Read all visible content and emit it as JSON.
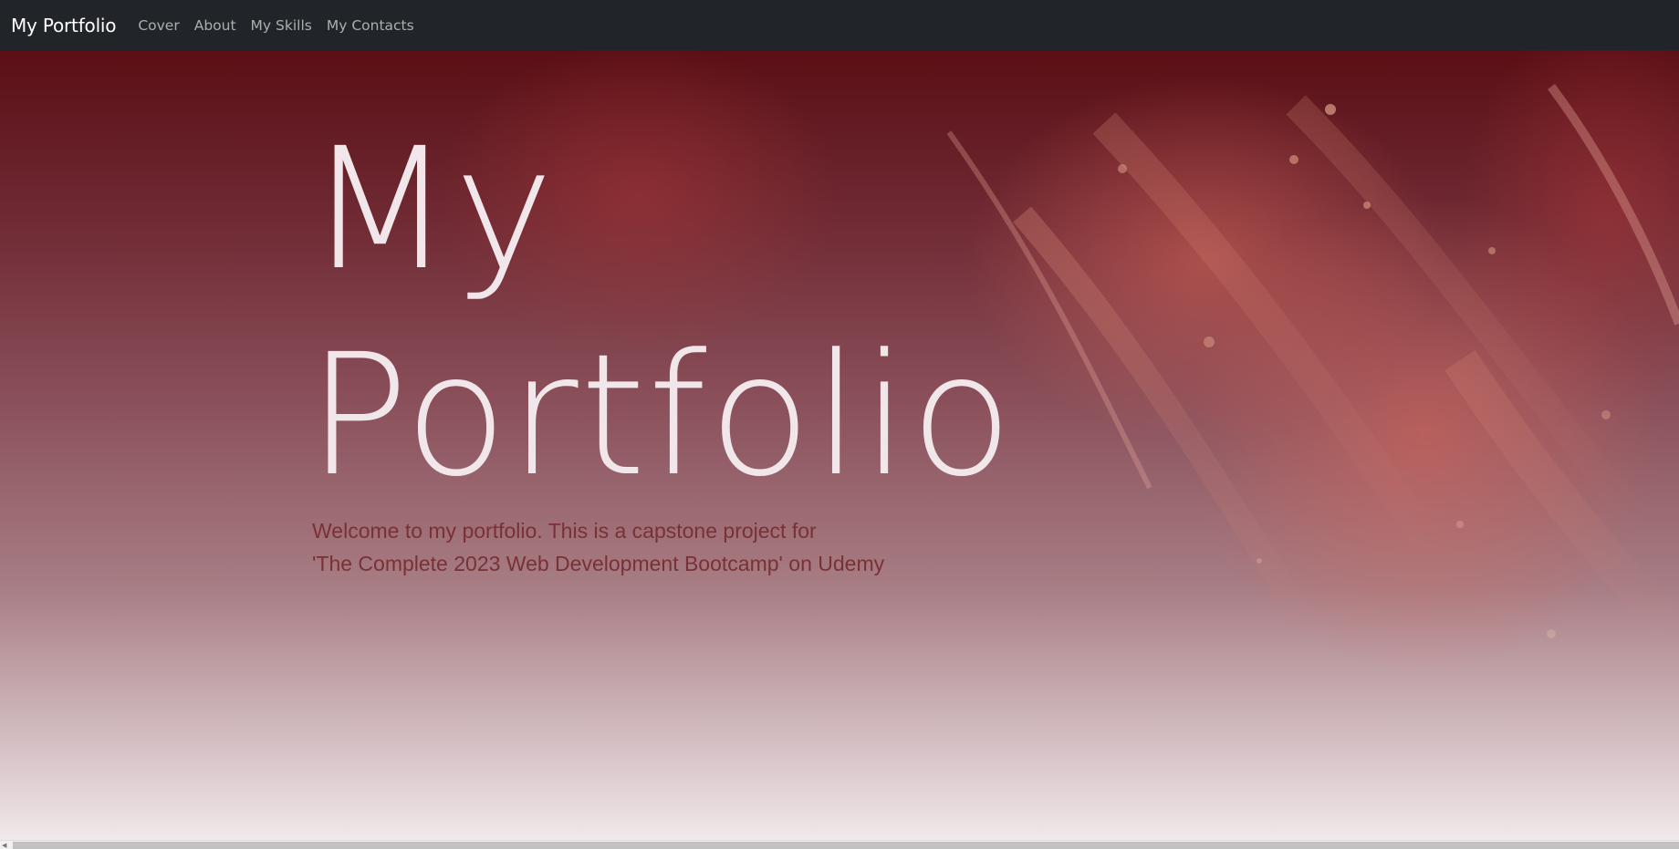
{
  "navbar": {
    "brand": "My Portfolio",
    "links": [
      {
        "label": "Cover"
      },
      {
        "label": "About"
      },
      {
        "label": "My Skills"
      },
      {
        "label": "My Contacts"
      }
    ],
    "background_color": "#212529"
  },
  "hero": {
    "title_line1": "My",
    "title_line2": "Portfolio",
    "description_line1": "Welcome to my portfolio. This is a capstone project for",
    "description_line2": "'The Complete 2023 Web Development Bootcamp' on Udemy",
    "title_color": "#f1e6e9",
    "text_color": "#7a3136",
    "background_top_color": "#5a0e14",
    "background_bottom_color": "#f3ecee"
  },
  "scrollbar": {
    "arrow_icon": "chevron-left-icon"
  }
}
